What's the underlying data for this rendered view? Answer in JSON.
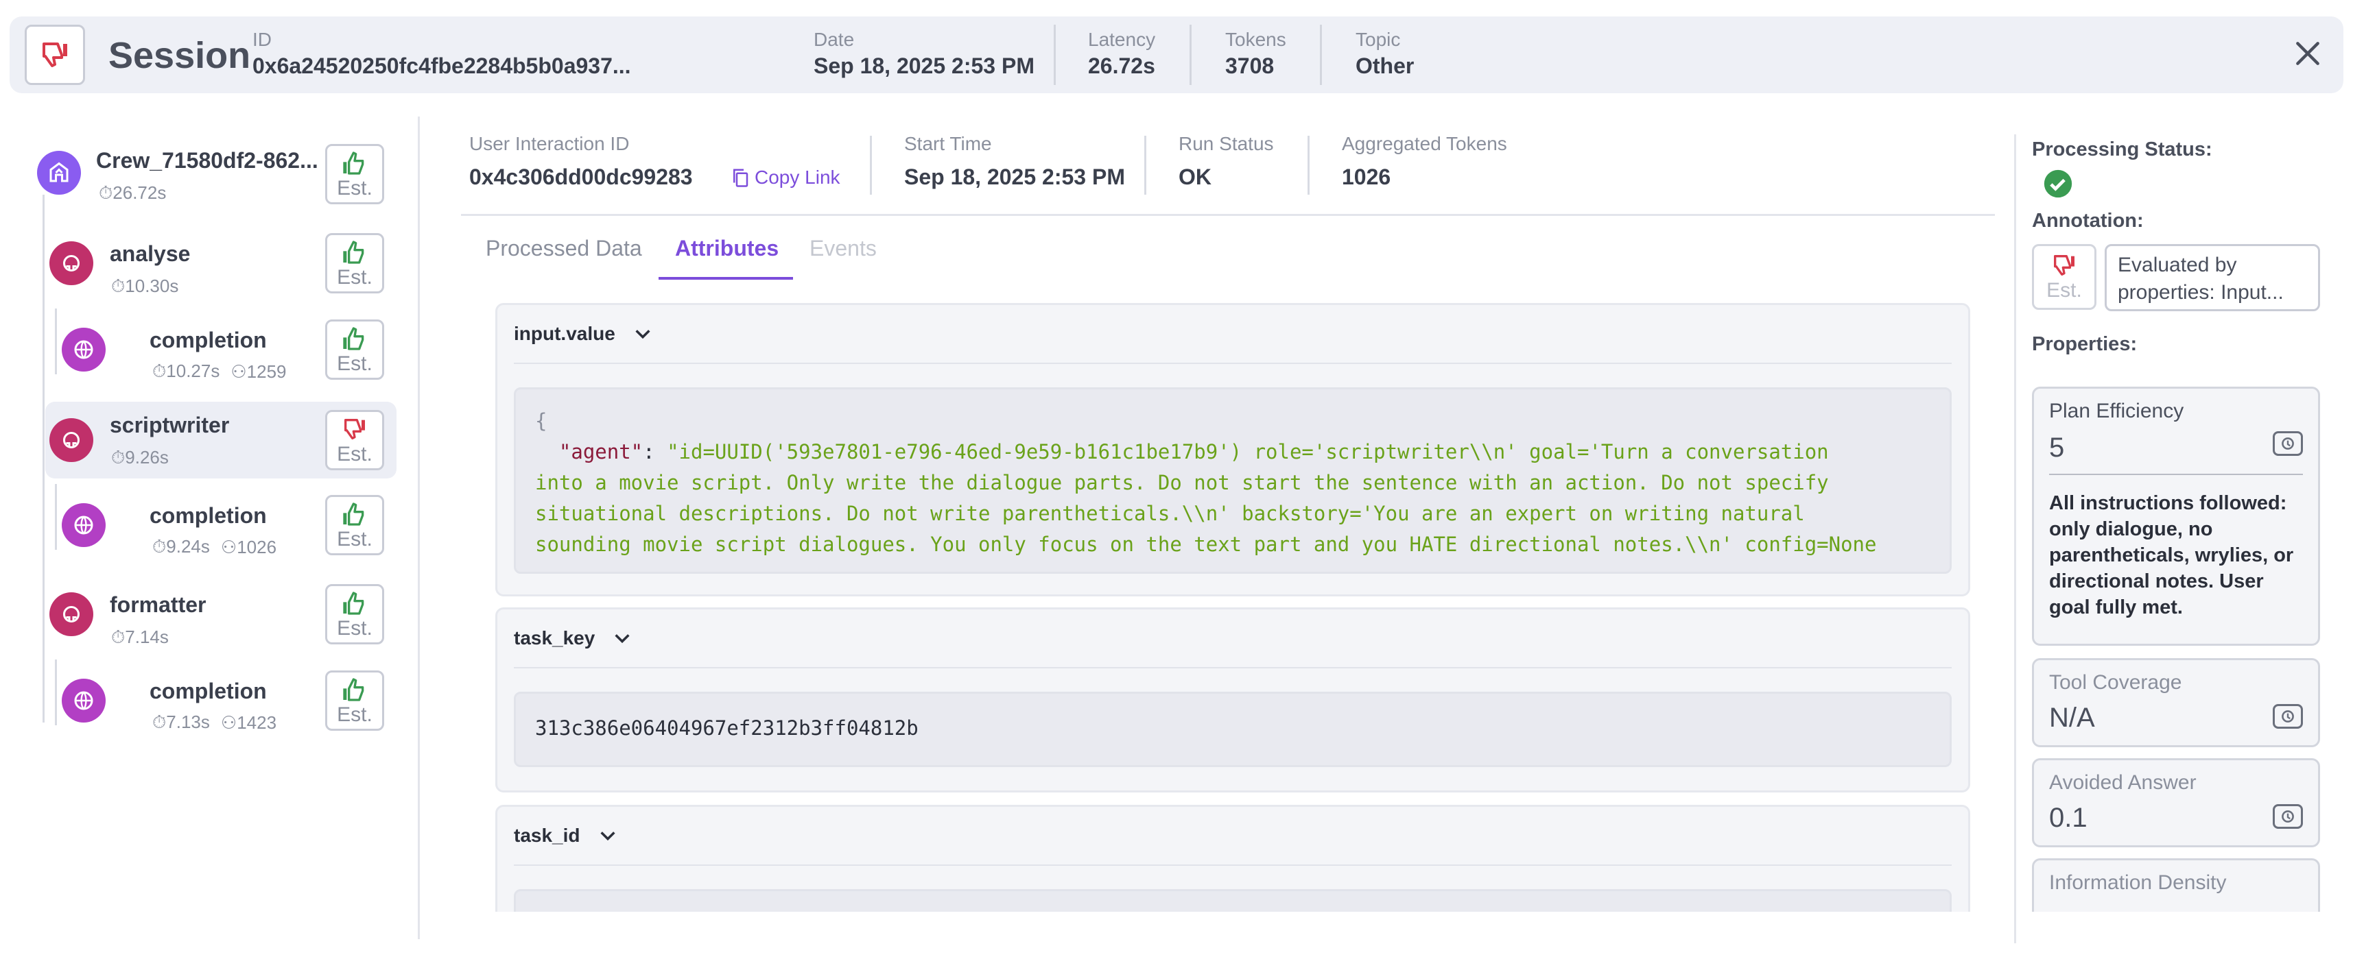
{
  "header": {
    "title": "Session",
    "id_label": "ID",
    "id_value": "0x6a24520250fc4fbe2284b5b0a937...",
    "date_label": "Date",
    "date_value": "Sep 18, 2025 2:53 PM",
    "latency_label": "Latency",
    "latency_value": "26.72s",
    "tokens_label": "Tokens",
    "tokens_value": "3708",
    "topic_label": "Topic",
    "topic_value": "Other"
  },
  "tree": {
    "est_label": "Est.",
    "items": [
      {
        "title": "Crew_71580df2-862...",
        "time": "26.72s",
        "tokens": "",
        "vote": "up"
      },
      {
        "title": "analyse",
        "time": "10.30s",
        "tokens": "",
        "vote": "up"
      },
      {
        "title": "completion",
        "time": "10.27s",
        "tokens": "1259",
        "vote": "up"
      },
      {
        "title": "scriptwriter",
        "time": "9.26s",
        "tokens": "",
        "vote": "down"
      },
      {
        "title": "completion",
        "time": "9.24s",
        "tokens": "1026",
        "vote": "up"
      },
      {
        "title": "formatter",
        "time": "7.14s",
        "tokens": "",
        "vote": "up"
      },
      {
        "title": "completion",
        "time": "7.13s",
        "tokens": "1423",
        "vote": "up"
      }
    ]
  },
  "meta": {
    "uid_label": "User Interaction ID",
    "uid_value": "0x4c306dd00dc99283",
    "copy_link": "Copy Link",
    "start_label": "Start Time",
    "start_value": "Sep 18, 2025 2:53 PM",
    "status_label": "Run Status",
    "status_value": "OK",
    "agg_label": "Aggregated Tokens",
    "agg_value": "1026"
  },
  "tabs": {
    "processed": "Processed Data",
    "attributes": "Attributes",
    "events": "Events"
  },
  "attributes": {
    "input_value": {
      "name": "input.value",
      "open_brace": "{",
      "key": "\"agent\"",
      "colon": ": ",
      "line1": "\"id=UUID('593e7801-e796-46ed-9e59-b161c1be17b9') role='scriptwriter\\\\n' goal='Turn a conversation",
      "line2": "into a movie script. Only write the dialogue parts. Do not start the sentence with an action. Do not specify",
      "line3": "situational descriptions. Do not write parentheticals.\\\\n' backstory='You are an expert on writing natural",
      "line4": "sounding movie script dialogues. You only focus on the text part and you HATE directional notes.\\\\n' config=None"
    },
    "task_key": {
      "name": "task_key",
      "value": "313c386e06404967ef2312b3ff04812b"
    },
    "task_id": {
      "name": "task_id"
    }
  },
  "right": {
    "processing_label": "Processing Status:",
    "annotation_label": "Annotation:",
    "annotation_est": "Est.",
    "annotation_text": "Evaluated by properties: Input...",
    "properties_label": "Properties:",
    "props": [
      {
        "title": "Plan Efficiency",
        "value": "5",
        "note": "All instructions followed: only dialogue, no parentheticals, wrylies, or directional notes. User goal fully met."
      },
      {
        "title": "Tool Coverage",
        "value": "N/A"
      },
      {
        "title": "Avoided Answer",
        "value": "0.1"
      },
      {
        "title": "Information Density",
        "value": ""
      }
    ]
  },
  "colors": {
    "accent": "#7c4ddb",
    "thumb_up": "#3a9b52",
    "thumb_down": "#d83a4a",
    "agent_icon": "#c0306a",
    "llm_icon": "#b23fc4",
    "crew_icon": "#8a5cf0",
    "status_ok": "#3a9b52"
  }
}
